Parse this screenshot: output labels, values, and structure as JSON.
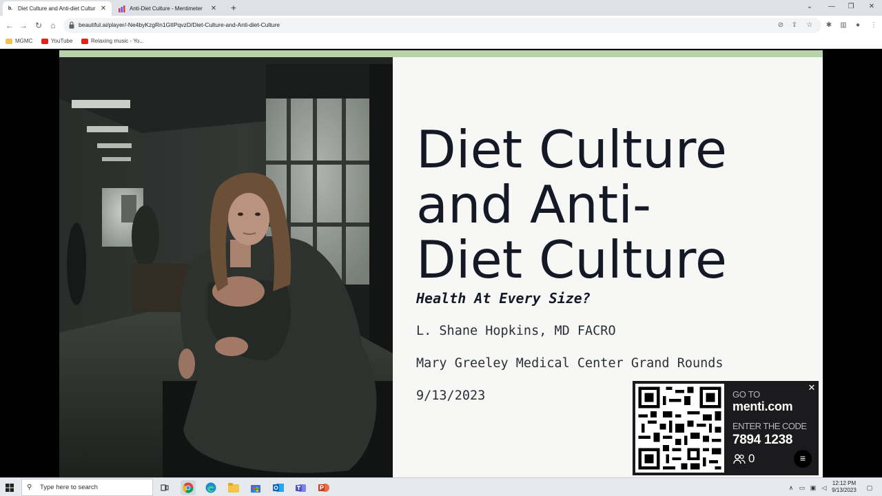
{
  "browser": {
    "tabs": [
      {
        "title": "Diet Culture and Anti-diet Cultur",
        "favicon": "b.",
        "active": true
      },
      {
        "title": "Anti-Diet Culture - Mentimeter",
        "favicon": "menti-icon",
        "active": false
      }
    ],
    "new_tab": "+",
    "url": "beautiful.ai/player/-Ne4byKzgRn1GtIPqvzD/Diet-Culture-and-Anti-diet-Culture",
    "bookmarks": [
      {
        "label": "MGMC",
        "icon": "folder-icon"
      },
      {
        "label": "YouTube",
        "icon": "youtube-icon"
      },
      {
        "label": "Relaxing music - Yo...",
        "icon": "youtube-icon"
      }
    ]
  },
  "slide": {
    "title_lines": [
      "Diet Culture",
      "and Anti-",
      "Diet Culture"
    ],
    "subtitle": "Health At Every Size?",
    "author": "L. Shane Hopkins, MD FACRO",
    "venue": "Mary Greeley Medical Center Grand Rounds",
    "date": "9/13/2023",
    "accent_color": "#b7d3aa"
  },
  "menti": {
    "goto_label": "GO TO",
    "site": "menti.com",
    "enter_label": "ENTER THE CODE",
    "code": "7894 1238",
    "participants": "0"
  },
  "taskbar": {
    "search_placeholder": "Type here to search",
    "time": "12:12 PM",
    "date": "9/13/2023"
  }
}
